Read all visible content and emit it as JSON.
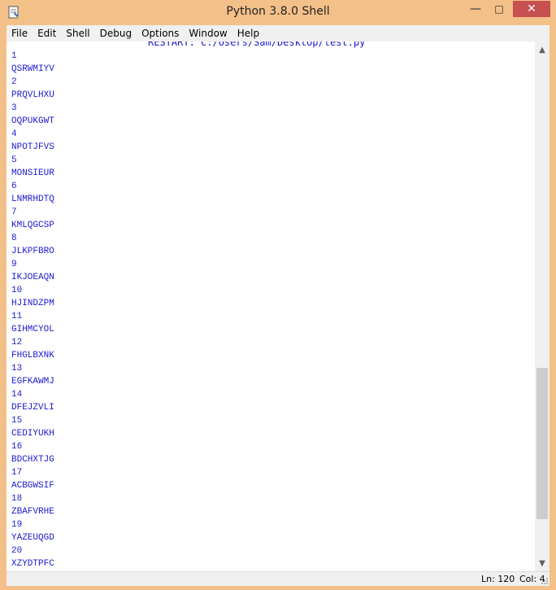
{
  "window": {
    "title": "Python 3.8.0 Shell"
  },
  "titlebar": {
    "minimize_glyph": "—",
    "maximize_glyph": "□",
    "close_glyph": "✕",
    "app_icon": "python-idle-icon"
  },
  "menu": {
    "items": [
      "File",
      "Edit",
      "Shell",
      "Debug",
      "Options",
      "Window",
      "Help"
    ]
  },
  "editor": {
    "restart_line": "RESTART: C:/Users/Sam/Desktop/test.py",
    "lines": [
      "1",
      "QSRWMIYV",
      "2",
      "PRQVLHXU",
      "3",
      "OQPUKGWT",
      "4",
      "NPOTJFVS",
      "5",
      "MONSIEUR",
      "6",
      "LNMRHDTQ",
      "7",
      "KMLQGCSP",
      "8",
      "JLKPFBRO",
      "9",
      "IKJOEAQN",
      "10",
      "HJINDZPM",
      "11",
      "GIHMCYOL",
      "12",
      "FHGLBXNK",
      "13",
      "EGFKAWMJ",
      "14",
      "DFEJZVLI",
      "15",
      "CEDIYUKH",
      "16",
      "BDCHXTJG",
      "17",
      "ACBGWSIF",
      "18",
      "ZBAFVRHE",
      "19",
      "YAZEUQGD",
      "20",
      "XZYDTPFC"
    ],
    "text_color": "#1a1ad0"
  },
  "scrollbar": {
    "up_arrow": "▲",
    "down_arrow": "▼"
  },
  "status": {
    "ln": "Ln: 120",
    "col": "Col: 4"
  },
  "colors": {
    "titlebar": "#f4c089",
    "close": "#c75050",
    "chrome": "#f0f0f0"
  }
}
